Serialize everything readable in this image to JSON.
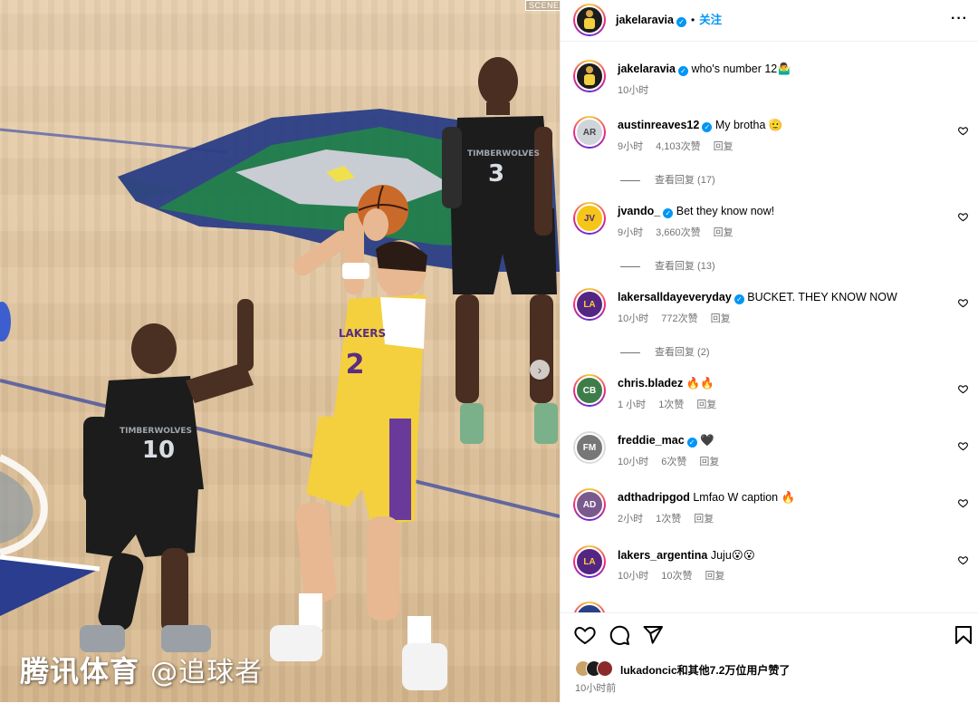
{
  "photo": {
    "scene_tag": "SCENE",
    "watermark_brand": "腾讯体育",
    "watermark_handle": "@追球者",
    "jersey_numbers": [
      "10",
      "2",
      "3"
    ],
    "jersey_text": [
      "TIMBERWOLVES",
      "LAKERS",
      "TIMBERWOLVES"
    ]
  },
  "header": {
    "username": "jakelaravia",
    "separator": "•",
    "follow_label": "关注",
    "more_icon": "more-horizontal-icon"
  },
  "caption": {
    "username": "jakelaravia",
    "text": "who's number 12🤷‍♂️",
    "time": "10小时"
  },
  "comments": [
    {
      "username": "austinreaves12",
      "verified": true,
      "text": "My brotha 🫡",
      "time": "9小时",
      "likes": "4,103次赞",
      "reply": "回复",
      "view_replies": "查看回复 (17)",
      "avatar_color": "#cfd4da"
    },
    {
      "username": "jvando_",
      "verified": true,
      "text": "Bet they know now!",
      "time": "9小时",
      "likes": "3,660次赞",
      "reply": "回复",
      "view_replies": "查看回复 (13)",
      "avatar_color": "#f5c518"
    },
    {
      "username": "lakersalldayeveryday",
      "verified": true,
      "text": "BUCKET. THEY KNOW NOW",
      "time": "10小时",
      "likes": "772次赞",
      "reply": "回复",
      "view_replies": "查看回复 (2)",
      "avatar_color": "#552583"
    },
    {
      "username": "chris.bladez",
      "verified": false,
      "text": "🔥🔥",
      "time": "1 小时",
      "likes": "1次赞",
      "reply": "回复",
      "view_replies": "",
      "avatar_color": "#3e7d4a"
    },
    {
      "username": "freddie_mac",
      "verified": true,
      "text": "🖤",
      "time": "10小时",
      "likes": "6次赞",
      "reply": "回复",
      "view_replies": "",
      "avatar_color": "#777777"
    },
    {
      "username": "adthadripgod",
      "verified": false,
      "text": "Lmfao W caption 🔥",
      "time": "2小时",
      "likes": "1次赞",
      "reply": "回复",
      "view_replies": "",
      "avatar_color": "#7a5a8c"
    },
    {
      "username": "lakers_argentina",
      "verified": false,
      "text": "Juju😮😮",
      "time": "10小时",
      "likes": "10次赞",
      "reply": "回复",
      "view_replies": "",
      "avatar_color": "#552583"
    }
  ],
  "footer": {
    "like_icon": "heart-icon",
    "comment_icon": "comment-icon",
    "share_icon": "send-icon",
    "save_icon": "bookmark-icon",
    "likes_text": "lukadoncic和其他7.2万位用户赞了",
    "time_ago": "10小时前"
  },
  "colors": {
    "accent": "#0095f6",
    "meta_gray": "#737373",
    "lakers_gold": "#f4d03f",
    "lakers_purple": "#552583",
    "wolves_black": "#1c1c1c"
  }
}
